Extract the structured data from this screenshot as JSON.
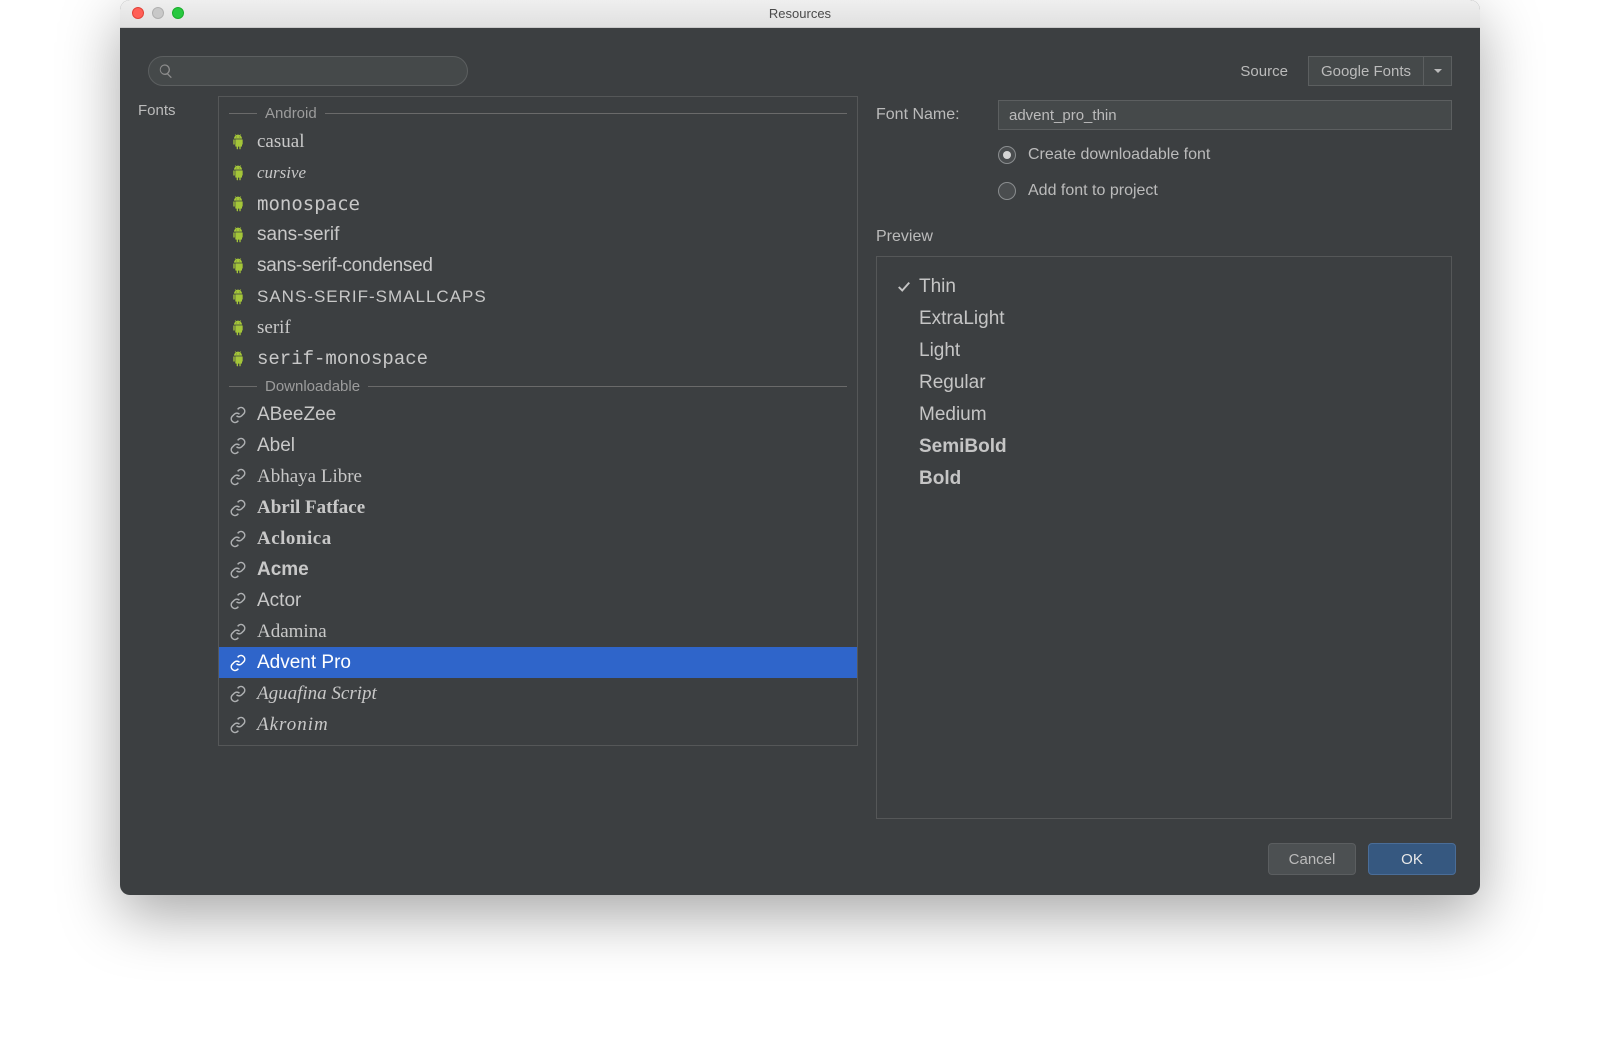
{
  "window": {
    "title": "Resources"
  },
  "search": {
    "placeholder": ""
  },
  "source": {
    "label": "Source",
    "value": "Google Fonts"
  },
  "left_label": "Fonts",
  "groups": {
    "android": {
      "label": "Android",
      "items": [
        {
          "name": "casual",
          "css": "ff-casual"
        },
        {
          "name": "cursive",
          "css": "ff-cursive"
        },
        {
          "name": "monospace",
          "css": "ff-mono"
        },
        {
          "name": "sans-serif",
          "css": "ff-sans"
        },
        {
          "name": "sans-serif-condensed",
          "css": "ff-sanscond"
        },
        {
          "name": "SANS-SERIF-SMALLCAPS",
          "css": "ff-smallcaps"
        },
        {
          "name": "serif",
          "css": "ff-serif"
        },
        {
          "name": "serif-monospace",
          "css": "ff-serifmono"
        }
      ]
    },
    "downloadable": {
      "label": "Downloadable",
      "items": [
        {
          "name": "ABeeZee",
          "css": "ff-abeezee"
        },
        {
          "name": "Abel",
          "css": "ff-abel"
        },
        {
          "name": "Abhaya Libre",
          "css": "ff-abhaya"
        },
        {
          "name": "Abril Fatface",
          "css": "ff-abril"
        },
        {
          "name": "Aclonica",
          "css": "ff-aclonica"
        },
        {
          "name": "Acme",
          "css": "ff-acme"
        },
        {
          "name": "Actor",
          "css": "ff-actor"
        },
        {
          "name": "Adamina",
          "css": "ff-adamina"
        },
        {
          "name": "Advent Pro",
          "css": "ff-advent",
          "selected": true
        },
        {
          "name": "Aguafina Script",
          "css": "ff-aguafina"
        },
        {
          "name": "Akronim",
          "css": "ff-akronim"
        }
      ]
    }
  },
  "form": {
    "font_name_label": "Font Name:",
    "font_name_value": "advent_pro_thin",
    "radio_downloadable": "Create downloadable font",
    "radio_add": "Add font to project",
    "radio_selected": "downloadable"
  },
  "preview": {
    "label": "Preview",
    "weights": [
      {
        "label": "Thin",
        "w": "w100",
        "checked": true
      },
      {
        "label": "ExtraLight",
        "w": "w200",
        "checked": false
      },
      {
        "label": "Light",
        "w": "w300",
        "checked": false
      },
      {
        "label": "Regular",
        "w": "w400",
        "checked": false
      },
      {
        "label": "Medium",
        "w": "w500",
        "checked": false
      },
      {
        "label": "SemiBold",
        "w": "w600",
        "checked": false
      },
      {
        "label": "Bold",
        "w": "w700",
        "checked": false
      }
    ]
  },
  "buttons": {
    "cancel": "Cancel",
    "ok": "OK"
  }
}
